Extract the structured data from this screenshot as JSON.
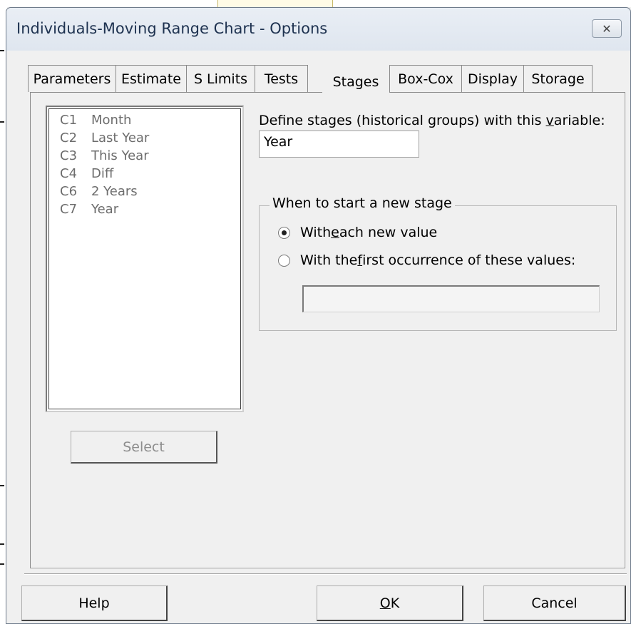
{
  "window": {
    "title": "Individuals-Moving Range Chart - Options",
    "close_icon": "close-icon"
  },
  "tabs": [
    {
      "label": "Parameters",
      "active": false
    },
    {
      "label": "Estimate",
      "active": false
    },
    {
      "label": "S Limits",
      "active": false
    },
    {
      "label": "Tests",
      "active": false
    },
    {
      "label": "Stages",
      "active": true
    },
    {
      "label": "Box-Cox",
      "active": false
    },
    {
      "label": "Display",
      "active": false
    },
    {
      "label": "Storage",
      "active": false
    }
  ],
  "variables": [
    {
      "col": "C1",
      "name": "Month"
    },
    {
      "col": "C2",
      "name": "Last Year"
    },
    {
      "col": "C3",
      "name": "This Year"
    },
    {
      "col": "C4",
      "name": "Diff"
    },
    {
      "col": "C6",
      "name": "2 Years"
    },
    {
      "col": "C7",
      "name": "Year"
    }
  ],
  "select_button": "Select",
  "stages": {
    "define_label_pre": "Define stages (historical groups) with this ",
    "define_label_accel": "v",
    "define_label_post": "ariable:",
    "define_value": "Year",
    "group_title": "When to start a new stage",
    "option1_pre": "With ",
    "option1_accel": "e",
    "option1_post": "ach new value",
    "option2_pre": "With the ",
    "option2_accel": "f",
    "option2_post": "irst occurrence of these values:",
    "selected_option": 1,
    "values_input": ""
  },
  "buttons": {
    "help": "Help",
    "ok_accel": "O",
    "ok_rest": "K",
    "cancel": "Cancel"
  }
}
